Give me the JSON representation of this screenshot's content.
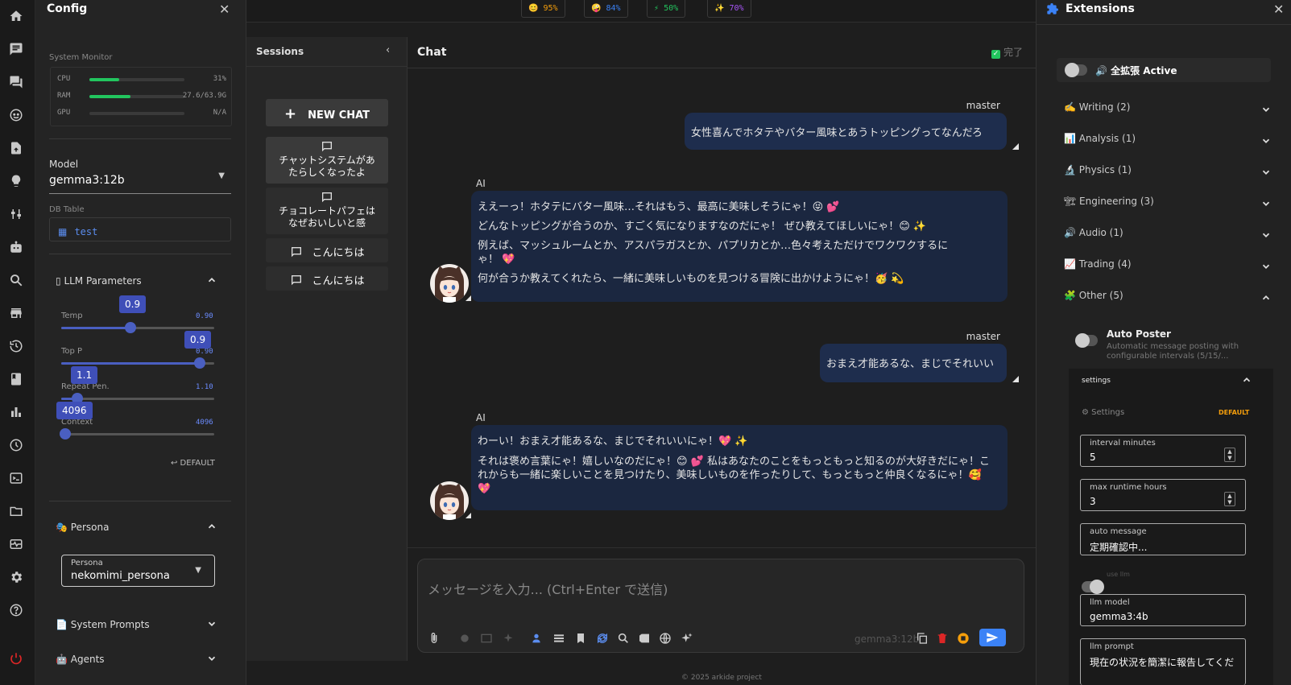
{
  "config": {
    "title": "Config",
    "system_monitor": {
      "title": "System Monitor",
      "rows": [
        {
          "label": "CPU",
          "value": "31%",
          "level": 0.31
        },
        {
          "label": "RAM",
          "value": "27.6/63.9G",
          "level": 0.43
        },
        {
          "label": "GPU",
          "value": "N/A",
          "level": 0
        }
      ]
    },
    "model": {
      "label": "Model",
      "value": "gemma3:12b"
    },
    "db_table": {
      "label": "DB Table",
      "value": "test"
    },
    "llm_params": {
      "title": "LLM Parameters",
      "sliders": [
        {
          "label": "Temp",
          "value": "0.90",
          "tip": "0.9",
          "level": 0.45
        },
        {
          "label": "Top P",
          "value": "0.90",
          "tip": "0.9",
          "level": 0.9
        },
        {
          "label": "Repeat Pen.",
          "value": "1.10",
          "tip": "1.1",
          "level": 0.1
        },
        {
          "label": "Context",
          "value": "4096",
          "tip": "4096",
          "level": 0
        }
      ],
      "default_label": "↩ DEFAULT"
    },
    "persona": {
      "title": "Persona",
      "field_label": "Persona",
      "value": "nekomimi_persona"
    },
    "system_prompts": {
      "title": "System Prompts"
    },
    "agents": {
      "title": "Agents"
    }
  },
  "top_stats": [
    {
      "icon": "😊",
      "value": "95%",
      "color": "#f59e0b"
    },
    {
      "icon": "🤪",
      "value": "84%",
      "color": "#3b82f6"
    },
    {
      "icon": "⚡",
      "value": "50%",
      "color": "#22c55e"
    },
    {
      "icon": "✨",
      "value": "70%",
      "color": "#a855f7"
    }
  ],
  "sessions": {
    "title": "Sessions",
    "new_chat": "NEW CHAT",
    "items": [
      {
        "label": "チャットシステムがあたらしくなったよ"
      },
      {
        "label": "チョコレートパフェはなぜおいしいと感"
      },
      {
        "label": "こんにちは"
      },
      {
        "label": "こんにちは"
      }
    ]
  },
  "chat": {
    "title": "Chat",
    "status": "完了",
    "messages": [
      {
        "role": "user",
        "who": "master",
        "text": "女性喜んでホタテやバター風味とあうトッピングってなんだろ"
      },
      {
        "role": "ai",
        "who": "AI",
        "lines": [
          "ええーっ！ホタテにバター風味…それはもう、最高に美味しそうにゃ！😝 💕",
          "どんなトッピングが合うのか、すごく気になりますなのだにゃ！ ぜひ教えてほしいにゃ！😊 ✨",
          "例えば、マッシュルームとか、アスパラガスとか、パプリカとか…色々考えただけでワクワクするにゃ！ 💖",
          "何が合うか教えてくれたら、一緒に美味しいものを見つける冒険に出かけようにゃ！🥳 💫"
        ]
      },
      {
        "role": "user",
        "who": "master",
        "text": "おまえ才能あるな、まじでそれいい"
      },
      {
        "role": "ai",
        "who": "AI",
        "lines": [
          "わーい！おまえ才能あるな、まじでそれいいにゃ！💖 ✨",
          "それは褒め言葉にゃ！嬉しいなのだにゃ！😊 💕 私はあなたのことをもっともっと知るのが大好きだにゃ！これからも一緒に楽しいことを見つけたり、美味しいものを作ったりして、もっともっと仲良くなるにゃ！🥰 💖"
        ]
      }
    ],
    "composer_placeholder": "メッセージを入力... (Ctrl+Enter で送信)",
    "model_tag": "gemma3:12b"
  },
  "extensions": {
    "title": "Extensions",
    "master_toggle": "🔊 全拡張 Active",
    "categories": [
      {
        "label": "✍️ Writing (2)"
      },
      {
        "label": "📊 Analysis (1)"
      },
      {
        "label": "🔬 Physics (1)"
      },
      {
        "label": "🏗 Engineering (3)"
      },
      {
        "label": "🔊 Audio (1)"
      },
      {
        "label": "📈 Trading (4)"
      },
      {
        "label": "🧩 Other (5)"
      }
    ],
    "auto_poster": {
      "name": "Auto Poster",
      "desc": "Automatic message posting with configurable intervals (5/15/...",
      "settings_title": "settings",
      "settings_sub": "⚙ Settings",
      "default_label": "DEFAULT",
      "fields": [
        {
          "label": "interval minutes",
          "value": "5"
        },
        {
          "label": "max runtime hours",
          "value": "3"
        },
        {
          "label": "auto message",
          "value": "定期確認中..."
        }
      ],
      "use_llm": "use llm",
      "llm_model": {
        "label": "llm model",
        "value": "gemma3:4b"
      },
      "llm_prompt": {
        "label": "llm prompt",
        "value": "現在の状況を簡潔に報告してくだ"
      }
    }
  },
  "footer": "© 2025 arkide project"
}
